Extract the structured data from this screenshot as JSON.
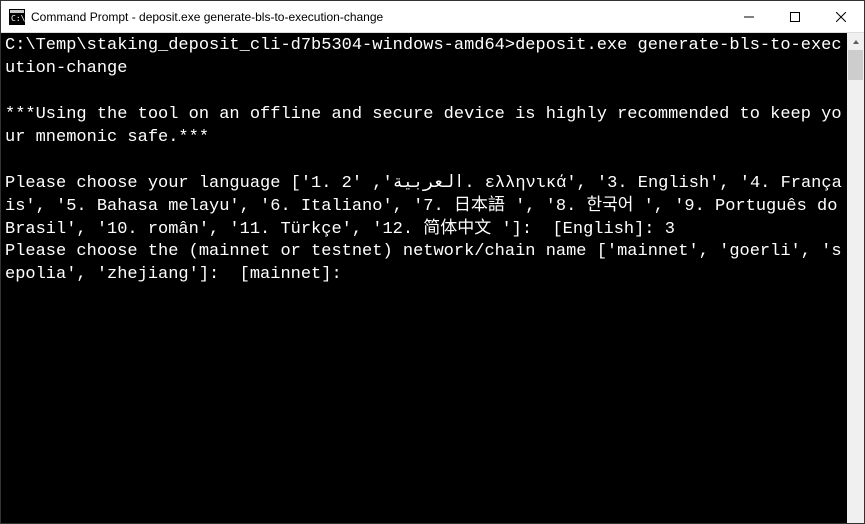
{
  "window": {
    "title": "Command Prompt - deposit.exe  generate-bls-to-execution-change"
  },
  "terminal": {
    "prompt_path": "C:\\Temp\\staking_deposit_cli-d7b5304-windows-amd64>",
    "command": "deposit.exe generate-bls-to-execution-change",
    "warning": "***Using the tool on an offline and secure device is highly recommended to keep your mnemonic safe.***",
    "language_prompt": "Please choose your language ['1. العربية', '2. ελληνικά', '3. English', '4. Français', '5. Bahasa melayu', '6. Italiano', '7. 日本語 ', '8. 한국어 ', '9. Português do Brasil', '10. român', '11. Türkçe', '12. 简体中文 ']:  [English]: ",
    "language_input": "3",
    "network_prompt": "Please choose the (mainnet or testnet) network/chain name ['mainnet', 'goerli', 'sepolia', 'zhejiang']:  [mainnet]: "
  }
}
